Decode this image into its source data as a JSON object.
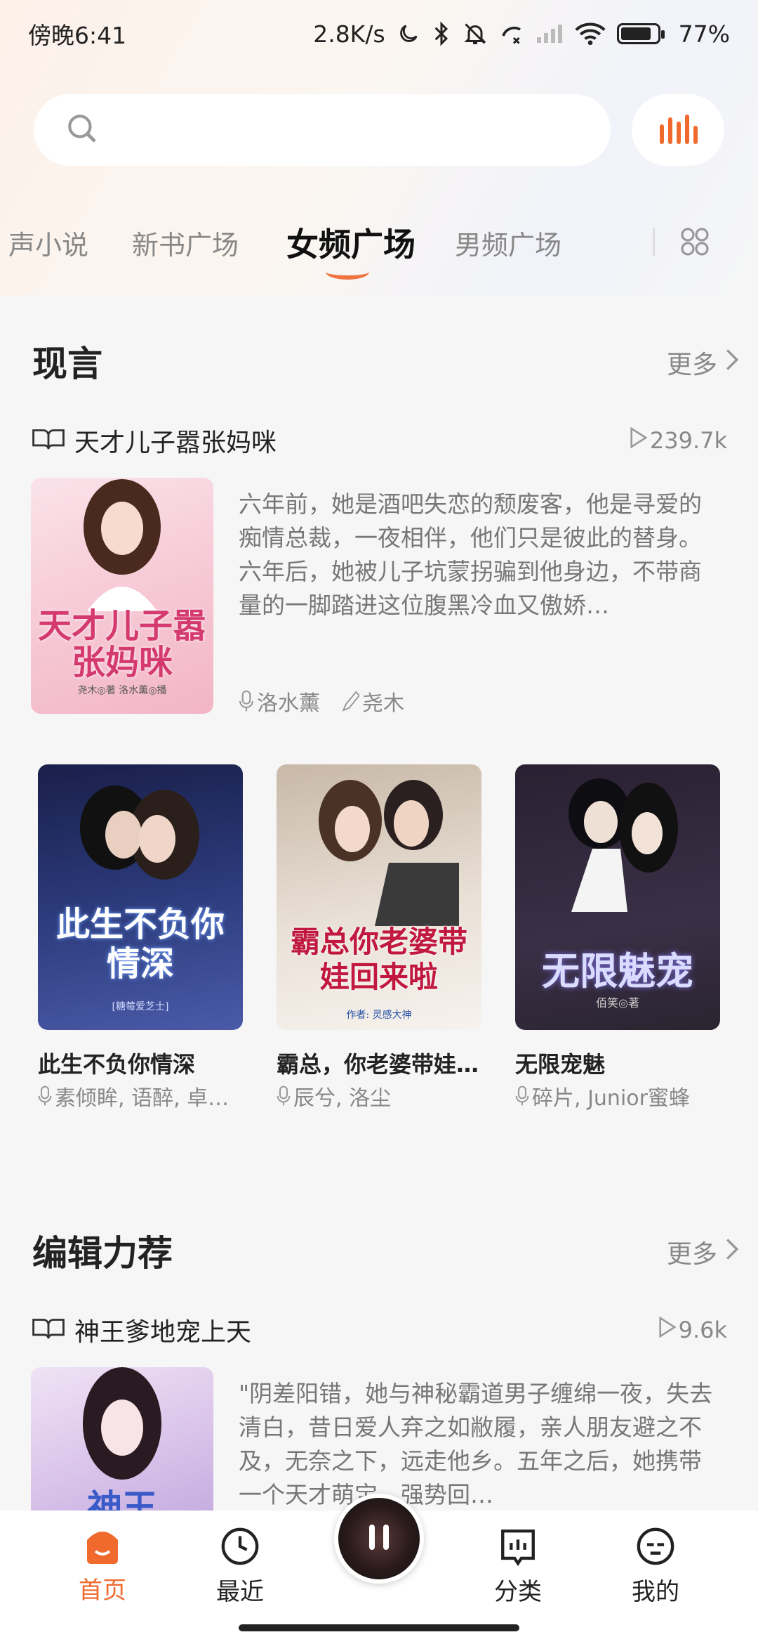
{
  "status_bar": {
    "time": "傍晚6:41",
    "speed": "2.8K/s",
    "battery": "77%"
  },
  "search": {
    "placeholder": ""
  },
  "tabs": [
    "声小说",
    "新书广场",
    "女频广场",
    "男频广场"
  ],
  "active_tab": "女频广场",
  "section1": {
    "title": "现言",
    "more": "更多",
    "featured": {
      "title": "天才儿子嚣张妈咪",
      "plays": "239.7k",
      "cover_text": "天才儿子嚣张妈咪",
      "cover_credit": "尧木◎著 洛水薰◎播",
      "description": "六年前，她是酒吧失恋的颓废客，他是寻爱的痴情总裁，一夜相伴，他们只是彼此的替身。 六年后，她被儿子坑蒙拐骗到他身边，不带商量的一脚踏进这位腹黑冷血又傲娇…",
      "narrator": "洛水薰",
      "author": "尧木"
    },
    "grid": [
      {
        "title": "此生不负你情深",
        "sub": "素倾眸, 语醉, 卓…",
        "cover_text": "此生不负你情深",
        "cover_small": "[糖莓爱芝士]"
      },
      {
        "title": "霸总，你老婆带娃…",
        "sub": "辰兮, 洛尘",
        "cover_text": "霸总你老婆带娃回来啦",
        "cover_small": "作者: 灵感大神"
      },
      {
        "title": "无限宠魅",
        "sub": "碎片, Junior蜜蜂",
        "cover_text": "无限魅宠",
        "cover_small": "佰笑◎著"
      }
    ]
  },
  "section2": {
    "title": "编辑力荐",
    "more": "更多",
    "featured": {
      "title": "神王爹地宠上天",
      "plays": "9.6k",
      "cover_text": "神王",
      "description": "\"阴差阳错，她与神秘霸道男子缠绵一夜，失去清白，昔日爱人弃之如敝履，亲人朋友避之不及，无奈之下，远走他乡。五年之后，她携带一个天才萌宝，强势回…"
    }
  },
  "bottom_nav": [
    {
      "label": "首页"
    },
    {
      "label": "最近"
    },
    {
      "label": "分类"
    },
    {
      "label": "我的"
    }
  ],
  "colors": {
    "accent": "#f06a2e",
    "text": "#222222",
    "muted": "#888888"
  }
}
